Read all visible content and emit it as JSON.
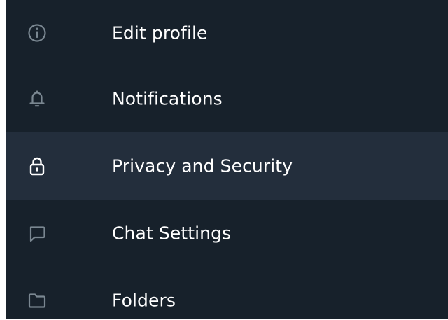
{
  "settings_menu": {
    "items": [
      {
        "label": "Edit profile",
        "icon": "info-circle-icon",
        "active": false
      },
      {
        "label": "Notifications",
        "icon": "bell-icon",
        "active": false
      },
      {
        "label": "Privacy and Security",
        "icon": "lock-icon",
        "active": true
      },
      {
        "label": "Chat Settings",
        "icon": "chat-bubble-icon",
        "active": false
      },
      {
        "label": "Folders",
        "icon": "folder-icon",
        "active": false
      }
    ]
  },
  "colors": {
    "background": "#17212b",
    "active_background": "#232e3c",
    "text": "#ffffff",
    "icon_muted": "#7a8791",
    "icon_active": "#ffffff"
  }
}
